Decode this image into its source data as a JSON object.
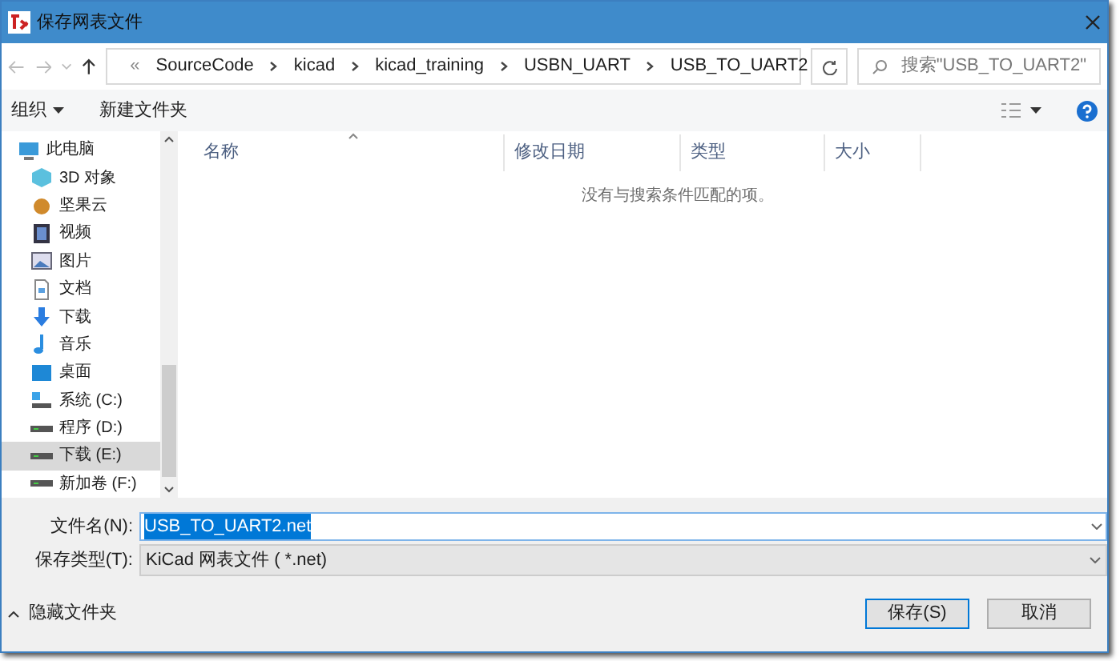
{
  "window": {
    "title": "保存网表文件"
  },
  "address": {
    "overflow": "«",
    "crumbs": [
      "SourceCode",
      "kicad",
      "kicad_training",
      "USBN_UART",
      "USB_TO_UART2"
    ]
  },
  "search": {
    "placeholder": "搜索\"USB_TO_UART2\""
  },
  "toolbar": {
    "organize": "组织",
    "new_folder": "新建文件夹"
  },
  "sidebar": {
    "items": [
      {
        "label": "此电脑",
        "kind": "pc",
        "selected": false
      },
      {
        "label": "3D 对象",
        "kind": "cube",
        "selected": false
      },
      {
        "label": "坚果云",
        "kind": "nut",
        "selected": false
      },
      {
        "label": "视频",
        "kind": "video",
        "selected": false
      },
      {
        "label": "图片",
        "kind": "image",
        "selected": false
      },
      {
        "label": "文档",
        "kind": "doc",
        "selected": false
      },
      {
        "label": "下载",
        "kind": "download",
        "selected": false
      },
      {
        "label": "音乐",
        "kind": "music",
        "selected": false
      },
      {
        "label": "桌面",
        "kind": "desktop",
        "selected": false
      },
      {
        "label": "系统 (C:)",
        "kind": "sysdrive",
        "selected": false
      },
      {
        "label": "程序 (D:)",
        "kind": "drive",
        "selected": false
      },
      {
        "label": "下载 (E:)",
        "kind": "drive",
        "selected": true
      },
      {
        "label": "新加卷 (F:)",
        "kind": "drive",
        "selected": false
      }
    ]
  },
  "table": {
    "columns": [
      "名称",
      "修改日期",
      "类型",
      "大小"
    ],
    "empty_message": "没有与搜索条件匹配的项。"
  },
  "form": {
    "filename_label": "文件名(N):",
    "filename": "USB_TO_UART2.net",
    "type_label": "保存类型(T):",
    "type": "KiCad 网表文件 ( *.net)"
  },
  "hide_folders": "隐藏文件夹",
  "buttons": [
    {
      "label": "保存(S)",
      "kind": "primary"
    },
    {
      "label": "取消",
      "kind": "normal"
    }
  ]
}
